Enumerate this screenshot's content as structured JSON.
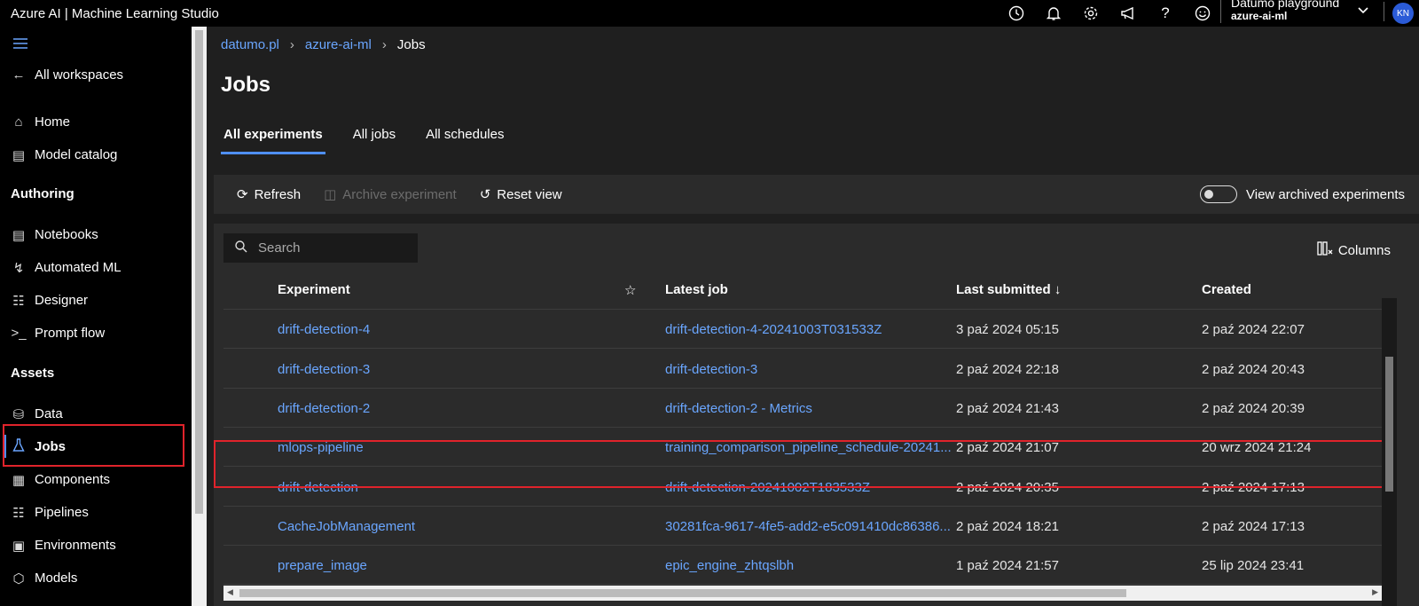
{
  "app": {
    "title": "Azure AI | Machine Learning Studio"
  },
  "topbar": {
    "icons": [
      "clock-icon",
      "bell-icon",
      "gear-icon",
      "megaphone-icon",
      "help-icon",
      "smiley-icon"
    ],
    "user_name": "Datumo playground",
    "workspace": "azure-ai-ml",
    "avatar_initials": "KN"
  },
  "sidebar": {
    "all_workspaces": "All workspaces",
    "home": "Home",
    "model_catalog": "Model catalog",
    "authoring_heading": "Authoring",
    "notebooks": "Notebooks",
    "automated_ml": "Automated ML",
    "designer": "Designer",
    "prompt_flow": "Prompt flow",
    "assets_heading": "Assets",
    "data": "Data",
    "jobs": "Jobs",
    "components": "Components",
    "pipelines": "Pipelines",
    "environments": "Environments",
    "models": "Models"
  },
  "breadcrumb": {
    "org": "datumo.pl",
    "workspace": "azure-ai-ml",
    "current": "Jobs"
  },
  "page": {
    "title": "Jobs"
  },
  "tabs": {
    "all_experiments": "All experiments",
    "all_jobs": "All jobs",
    "all_schedules": "All schedules"
  },
  "toolbar": {
    "refresh": "Refresh",
    "archive": "Archive experiment",
    "reset": "Reset view",
    "view_archived": "View archived experiments",
    "view_archived_on": false
  },
  "grid": {
    "search_placeholder": "Search",
    "columns_label": "Columns",
    "headers": {
      "experiment": "Experiment",
      "latest_job": "Latest job",
      "last_submitted": "Last submitted ↓",
      "created": "Created"
    },
    "rows": [
      {
        "experiment": "drift-detection-4",
        "latest_job": "drift-detection-4-20241003T031533Z",
        "last_submitted": "3 paź 2024 05:15",
        "created": "2 paź 2024 22:07"
      },
      {
        "experiment": "drift-detection-3",
        "latest_job": "drift-detection-3",
        "last_submitted": "2 paź 2024 22:18",
        "created": "2 paź 2024 20:43"
      },
      {
        "experiment": "drift-detection-2",
        "latest_job": "drift-detection-2 - Metrics",
        "last_submitted": "2 paź 2024 21:43",
        "created": "2 paź 2024 20:39"
      },
      {
        "experiment": "mlops-pipeline",
        "latest_job": "training_comparison_pipeline_schedule-20241...",
        "last_submitted": "2 paź 2024 21:07",
        "created": "20 wrz 2024 21:24"
      },
      {
        "experiment": "drift-detection",
        "latest_job": "drift-detection-20241002T183533Z",
        "last_submitted": "2 paź 2024 20:35",
        "created": "2 paź 2024 17:13"
      },
      {
        "experiment": "CacheJobManagement",
        "latest_job": "30281fca-9617-4fe5-add2-e5c091410dc86386...",
        "last_submitted": "2 paź 2024 18:21",
        "created": "2 paź 2024 17:13"
      },
      {
        "experiment": "prepare_image",
        "latest_job": "epic_engine_zhtqslbh",
        "last_submitted": "1 paź 2024 21:57",
        "created": "25 lip 2024 23:41"
      }
    ]
  },
  "colors": {
    "accent": "#4f8ff7",
    "link": "#6aa6ff",
    "highlight": "#e0232b"
  }
}
